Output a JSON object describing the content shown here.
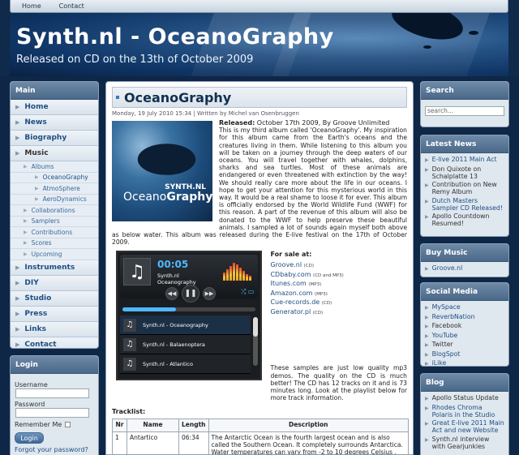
{
  "topnav": [
    "Home",
    "Contact"
  ],
  "header": {
    "title": "Synth.nl - OceanoGraphy",
    "subtitle": "Released on CD on the 13th of October 2009"
  },
  "left": {
    "main_title": "Main",
    "menu": [
      {
        "label": "Home"
      },
      {
        "label": "News"
      },
      {
        "label": "Biography"
      },
      {
        "label": "Music"
      }
    ],
    "music_sub": [
      {
        "label": "Albums",
        "level": 1
      },
      {
        "label": "OceanoGraphy",
        "level": 2
      },
      {
        "label": "AtmoSphere",
        "level": 2
      },
      {
        "label": "AeroDynamics",
        "level": 2
      },
      {
        "label": "Collaborations",
        "level": 1
      },
      {
        "label": "Samplers",
        "level": 1
      },
      {
        "label": "Contributions",
        "level": 1
      },
      {
        "label": "Scores",
        "level": 1
      },
      {
        "label": "Upcoming",
        "level": 1
      }
    ],
    "menu2": [
      {
        "label": "Instruments"
      },
      {
        "label": "DIY"
      },
      {
        "label": "Studio"
      },
      {
        "label": "Press"
      },
      {
        "label": "Links"
      },
      {
        "label": "Contact"
      }
    ],
    "login": {
      "title": "Login",
      "username_label": "Username",
      "password_label": "Password",
      "remember_label": "Remember Me",
      "button": "Login",
      "forgot": "Forgot your password?"
    }
  },
  "article": {
    "title": "OceanoGraphy",
    "meta": "Monday, 19 July 2010 15:34 | Written by Michel van Osenbruggen",
    "cover_brand": "SYNTH.NL",
    "cover_logo_a": "Oceano",
    "cover_logo_b": "Graphy",
    "released_label": "Released:",
    "released_text": " October 17th 2009, By Groove Unlimited",
    "body": "This is my third album called 'OceanoGraphy'. My inspiration for this album came from the Earth's oceans and the creatures living in them. While listening to this album you will be taken on a journey through the deep waters of our oceans. You will travel together with whales, dolphins, sharks and sea turtles. Most of these animals are endangered or even threatened with extinction by the way! We should really care more about the life in our oceans. I hope to get your attention for this mysterious world in this way. It would be a real shame to loose it for ever. This album is officially endorsed by the World Wildlife Fund (WWF) for this reason. A part of the revenue of this album will also be donated to the WWF to help preserve these beautiful animals. I sampled a lot of sounds again myself both above as below water. This album was released during the E-live festival on the 17th of October 2009.",
    "player": {
      "time": "00:05",
      "artist": "Synth.nl",
      "track": "Oceanography",
      "tracks": [
        "Synth.nl - Oceanography",
        "Synth.nl - Balaenoptera",
        "Synth.nl - Atlantico"
      ],
      "progress": 0.4
    },
    "sale": {
      "heading": "For sale at:",
      "links": [
        {
          "name": "Groove.nl",
          "note": "(CD)"
        },
        {
          "name": "CDbaby.com",
          "note": "(CD and MP3)"
        },
        {
          "name": "Itunes.com",
          "note": "(MP3)"
        },
        {
          "name": "Amazon.com",
          "note": "(MP3)"
        },
        {
          "name": "Cue-records.de",
          "note": "(CD)"
        },
        {
          "name": "Generator.pl",
          "note": "(CD)"
        }
      ]
    },
    "samples_text": "These samples are just low quality mp3 demos. The quality on the CD is much better! The CD has 12 tracks on it and is 73 minutes long. Look at the playlist below for more track information.",
    "tracklist_label": "Tracklist:",
    "table": {
      "headers": [
        "Nr",
        "Name",
        "Length",
        "Description"
      ],
      "rows": [
        [
          "1",
          "Antartico",
          "06:34",
          "The Antarctic Ocean is the fourth largest ocean and is also called the Southern Ocean. It completely surrounds Antarctica. Water temperatures can vary from -2 to 10 degrees Celsius , because"
        ]
      ]
    }
  },
  "right": {
    "search": {
      "title": "Search",
      "placeholder": "search..."
    },
    "latest": {
      "title": "Latest News",
      "items": [
        {
          "t": "E-live 2011 Main Act",
          "link": true
        },
        {
          "t": "Don Quixote on Schalplatte 13",
          "link": false
        },
        {
          "t": "Contribution on New Remy Album",
          "link": false
        },
        {
          "t": "Dutch Masters Sampler CD Released!",
          "link": true
        },
        {
          "t": "Apollo Countdown Resumed!",
          "link": false
        }
      ]
    },
    "buy": {
      "title": "Buy Music",
      "items": [
        {
          "t": "Groove.nl",
          "link": true
        }
      ]
    },
    "social": {
      "title": "Social Media",
      "items": [
        {
          "t": "MySpace",
          "link": true
        },
        {
          "t": "ReverbNation",
          "link": true
        },
        {
          "t": "Facebook",
          "link": false
        },
        {
          "t": "YouTube",
          "link": true
        },
        {
          "t": "Twitter",
          "link": false
        },
        {
          "t": "BlogSpot",
          "link": true
        },
        {
          "t": "iLike",
          "link": true
        }
      ]
    },
    "blog": {
      "title": "Blog",
      "items": [
        {
          "t": "Apollo Status Update",
          "link": false
        },
        {
          "t": "Rhodes Chroma Polaris in the Studio",
          "link": true
        },
        {
          "t": "Great E-live 2011 Main Act and new Website",
          "link": true
        },
        {
          "t": "Synth.nl interview with Gearjunkies",
          "link": false
        }
      ]
    }
  }
}
